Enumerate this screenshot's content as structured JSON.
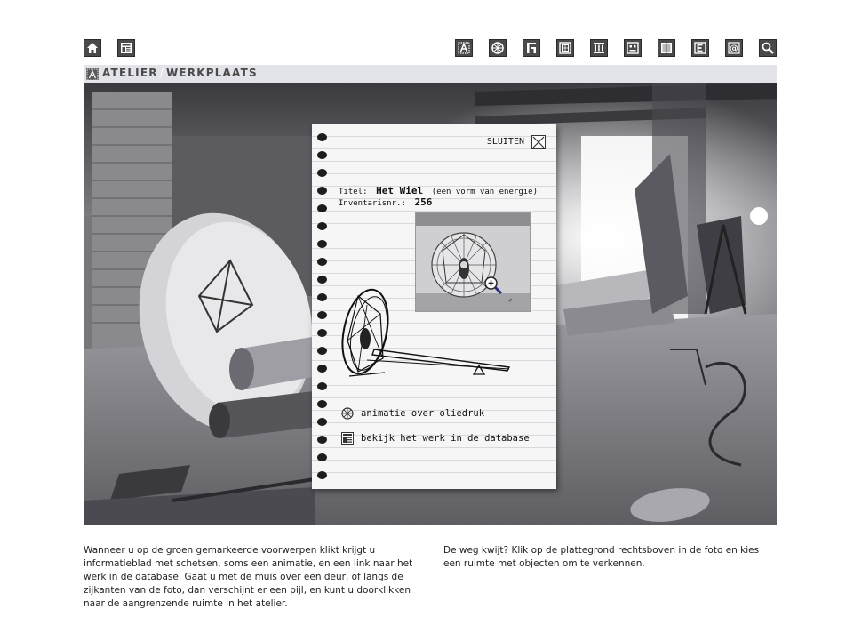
{
  "toolbar": {
    "left": [
      {
        "name": "home-icon"
      },
      {
        "name": "layout-icon"
      }
    ],
    "right": [
      {
        "name": "letter-a-icon"
      },
      {
        "name": "wheel-icon"
      },
      {
        "name": "letter-h-icon"
      },
      {
        "name": "grid-icon"
      },
      {
        "name": "columns-icon"
      },
      {
        "name": "face-icon"
      },
      {
        "name": "document-icon"
      },
      {
        "name": "letter-e-icon"
      },
      {
        "name": "at-icon"
      },
      {
        "name": "search-icon"
      }
    ]
  },
  "header": {
    "title_part1": "ATELIER",
    "separator": "/",
    "title_part2": "WERKPLAATS",
    "bar_color": "#e3e3ea"
  },
  "card": {
    "close_label": "SLUITEN",
    "title_key": "Titel:",
    "title_value": "Het Wiel",
    "title_extra": "(een vorm van energie)",
    "inventory_key": "Inventarisnr.:",
    "inventory_value": "256",
    "links": {
      "animation": "animatie over oliedruk",
      "database": "bekijk het werk in de database"
    }
  },
  "footer": {
    "left": "Wanneer u op de groen gemarkeerde voorwerpen klikt krijgt u informatieblad met schetsen, soms een animatie, en een link naar het werk in de database. Gaat u met de muis over een deur, of langs de zijkanten van de foto, dan verschijnt er een pijl, en kunt u doorklikken naar de aangrenzende ruimte in het atelier.",
    "right": "De weg kwijt? Klik op de plattegrond rechtsboven in de foto en kies een ruimte met objecten om te verkennen."
  }
}
